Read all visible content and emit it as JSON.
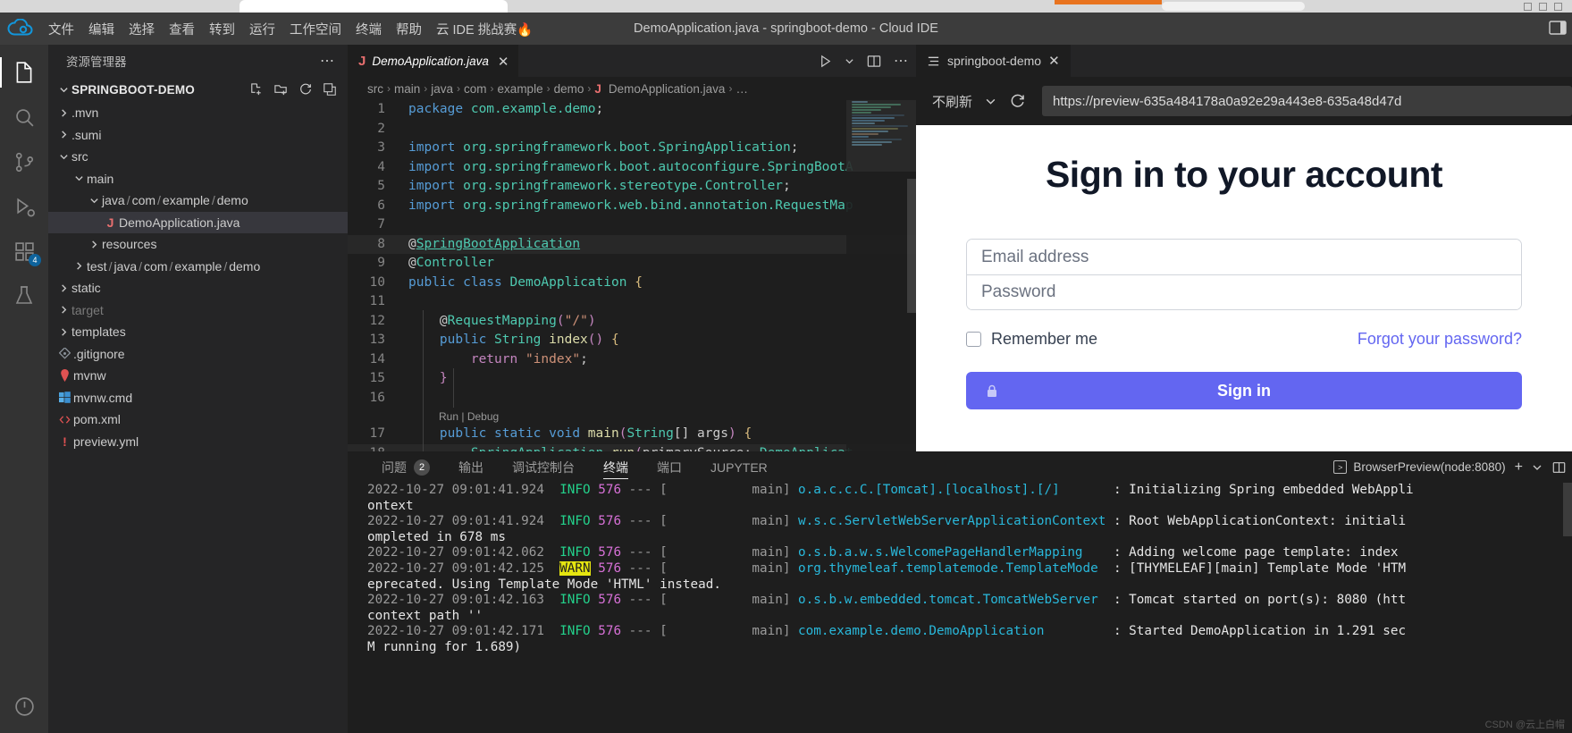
{
  "window": {
    "title": "DemoApplication.java - springboot-demo - Cloud IDE"
  },
  "menubar": {
    "logo": "cloud-logo-icon",
    "items": [
      {
        "label": "文件"
      },
      {
        "label": "编辑"
      },
      {
        "label": "选择"
      },
      {
        "label": "查看"
      },
      {
        "label": "转到"
      },
      {
        "label": "运行"
      },
      {
        "label": "工作空间"
      },
      {
        "label": "终端"
      },
      {
        "label": "帮助"
      },
      {
        "label": "云 IDE 挑战赛🔥"
      }
    ]
  },
  "activitybar": {
    "items": [
      {
        "name": "explorer",
        "icon": "files-icon",
        "active": true,
        "badge": ""
      },
      {
        "name": "search",
        "icon": "search-icon",
        "active": false,
        "badge": ""
      },
      {
        "name": "source-control",
        "icon": "source-control-icon",
        "active": false,
        "badge": ""
      },
      {
        "name": "run-and-debug",
        "icon": "debug-icon",
        "active": false,
        "badge": ""
      },
      {
        "name": "extensions",
        "icon": "extensions-icon",
        "active": false,
        "badge": "4"
      },
      {
        "name": "testing",
        "icon": "beaker-icon",
        "active": false,
        "badge": ""
      },
      {
        "name": "power",
        "icon": "power-icon",
        "active": false,
        "badge": ""
      }
    ]
  },
  "explorer": {
    "title": "资源管理器",
    "more_label": "⋯",
    "root": {
      "label": "SPRINGBOOT-DEMO",
      "actions": [
        "new-file-icon",
        "new-folder-icon",
        "refresh-icon",
        "collapse-all-icon"
      ]
    },
    "tree": [
      {
        "label": ".mvn",
        "indent": 1,
        "type": "folder",
        "expanded": false,
        "icon": "chevron-right-icon"
      },
      {
        "label": ".sumi",
        "indent": 1,
        "type": "folder",
        "expanded": false,
        "icon": "chevron-right-icon"
      },
      {
        "label": "src",
        "indent": 1,
        "type": "folder",
        "expanded": true,
        "icon": "chevron-down-icon"
      },
      {
        "label": "main",
        "indent": 2,
        "type": "folder",
        "expanded": true,
        "icon": "chevron-down-icon"
      },
      {
        "label": "java / com / example / demo",
        "indent": 3,
        "type": "folder",
        "expanded": true,
        "icon": "chevron-down-icon"
      },
      {
        "label": "DemoApplication.java",
        "indent": 4,
        "type": "java",
        "selected": true,
        "icon": "java-icon"
      },
      {
        "label": "resources",
        "indent": 3,
        "type": "folder",
        "expanded": false,
        "icon": "chevron-right-icon"
      },
      {
        "label": "test / java / com / example / demo",
        "indent": 2,
        "type": "folder",
        "expanded": false,
        "icon": "chevron-right-icon"
      },
      {
        "label": "static",
        "indent": 1,
        "type": "folder",
        "expanded": false,
        "icon": "chevron-right-icon"
      },
      {
        "label": "target",
        "indent": 1,
        "type": "folder",
        "expanded": false,
        "dim": true,
        "icon": "chevron-right-icon"
      },
      {
        "label": "templates",
        "indent": 1,
        "type": "folder",
        "expanded": false,
        "icon": "chevron-right-icon"
      },
      {
        "label": ".gitignore",
        "indent": 1,
        "type": "git",
        "icon": "git-icon"
      },
      {
        "label": "mvnw",
        "indent": 1,
        "type": "maven",
        "icon": "maven-icon"
      },
      {
        "label": "mvnw.cmd",
        "indent": 1,
        "type": "windows",
        "icon": "windows-icon"
      },
      {
        "label": "pom.xml",
        "indent": 1,
        "type": "xml",
        "icon": "xml-icon"
      },
      {
        "label": "preview.yml",
        "indent": 1,
        "type": "yml",
        "icon": "yml-icon"
      }
    ]
  },
  "editor": {
    "tab": {
      "label": "DemoApplication.java",
      "icon": "java-icon",
      "close": "✕"
    },
    "actions": [
      "run-icon",
      "chevron-down-icon",
      "split-editor-icon",
      "more-icon"
    ],
    "breadcrumb": [
      "src",
      "main",
      "java",
      "com",
      "example",
      "demo",
      "DemoApplication.java",
      "…"
    ],
    "breadcrumb_sep": "›",
    "codelens": {
      "run": "Run",
      "sep": "|",
      "debug": "Debug",
      "line": 16
    },
    "lines": [
      {
        "n": 1,
        "tokens": [
          {
            "t": "package ",
            "c": "k"
          },
          {
            "t": "com.example.demo",
            "c": "t"
          },
          {
            "t": ";",
            "c": "pl"
          }
        ]
      },
      {
        "n": 2,
        "tokens": []
      },
      {
        "n": 3,
        "tokens": [
          {
            "t": "import ",
            "c": "k"
          },
          {
            "t": "org.springframework.boot.SpringApplication",
            "c": "t"
          },
          {
            "t": ";",
            "c": "pl"
          }
        ]
      },
      {
        "n": 4,
        "tokens": [
          {
            "t": "import ",
            "c": "k"
          },
          {
            "t": "org.springframework.boot.autoconfigure.SpringBootA",
            "c": "t"
          }
        ]
      },
      {
        "n": 5,
        "tokens": [
          {
            "t": "import ",
            "c": "k"
          },
          {
            "t": "org.springframework.stereotype.Controller",
            "c": "t"
          },
          {
            "t": ";",
            "c": "pl"
          }
        ]
      },
      {
        "n": 6,
        "tokens": [
          {
            "t": "import ",
            "c": "k"
          },
          {
            "t": "org.springframework.web.bind.annotation.RequestMap",
            "c": "t"
          }
        ]
      },
      {
        "n": 7,
        "tokens": []
      },
      {
        "n": 8,
        "tokens": [
          {
            "t": "@",
            "c": "pl"
          },
          {
            "t": "SpringBootApplication",
            "c": "anu"
          }
        ]
      },
      {
        "n": 9,
        "tokens": [
          {
            "t": "@",
            "c": "pl"
          },
          {
            "t": "Controller",
            "c": "an"
          }
        ]
      },
      {
        "n": 10,
        "tokens": [
          {
            "t": "public ",
            "c": "k"
          },
          {
            "t": "class ",
            "c": "k"
          },
          {
            "t": "DemoApplication",
            "c": "t"
          },
          {
            "t": " ",
            "c": "pl"
          },
          {
            "t": "{",
            "c": "br"
          }
        ]
      },
      {
        "n": 11,
        "tokens": []
      },
      {
        "n": 12,
        "tokens": [
          {
            "t": "    @",
            "c": "pl"
          },
          {
            "t": "RequestMapping",
            "c": "an"
          },
          {
            "t": "(",
            "c": "kp"
          },
          {
            "t": "\"/\"",
            "c": "s"
          },
          {
            "t": ")",
            "c": "kp"
          }
        ]
      },
      {
        "n": 13,
        "tokens": [
          {
            "t": "    ",
            "c": "pl"
          },
          {
            "t": "public ",
            "c": "k"
          },
          {
            "t": "String ",
            "c": "t"
          },
          {
            "t": "index",
            "c": "fn"
          },
          {
            "t": "()",
            "c": "kp"
          },
          {
            "t": " ",
            "c": "pl"
          },
          {
            "t": "{",
            "c": "br"
          }
        ]
      },
      {
        "n": 14,
        "tokens": [
          {
            "t": "        ",
            "c": "pl"
          },
          {
            "t": "return ",
            "c": "kp"
          },
          {
            "t": "\"index\"",
            "c": "s"
          },
          {
            "t": ";",
            "c": "pl"
          }
        ]
      },
      {
        "n": 15,
        "tokens": [
          {
            "t": "    ",
            "c": "pl"
          },
          {
            "t": "}",
            "c": "kp"
          }
        ]
      },
      {
        "n": 16,
        "tokens": []
      },
      {
        "n": 17,
        "tokens": [
          {
            "t": "    ",
            "c": "pl"
          },
          {
            "t": "public ",
            "c": "k"
          },
          {
            "t": "static ",
            "c": "k"
          },
          {
            "t": "void ",
            "c": "k"
          },
          {
            "t": "main",
            "c": "fn"
          },
          {
            "t": "(",
            "c": "kp"
          },
          {
            "t": "String",
            "c": "t"
          },
          {
            "t": "[] ",
            "c": "pl"
          },
          {
            "t": "args",
            "c": "pl"
          },
          {
            "t": ")",
            "c": "kp"
          },
          {
            "t": " ",
            "c": "pl"
          },
          {
            "t": "{",
            "c": "br"
          }
        ]
      },
      {
        "n": 18,
        "tokens": [
          {
            "t": "        ",
            "c": "pl"
          },
          {
            "t": "SpringApplication",
            "c": "t"
          },
          {
            "t": ".",
            "c": "pl"
          },
          {
            "t": "run",
            "c": "fn"
          },
          {
            "t": "(",
            "c": "kp"
          },
          {
            "t": "primarySource:",
            "c": "pl"
          },
          {
            "t": " DemoApplicat",
            "c": "t"
          }
        ]
      }
    ]
  },
  "preview": {
    "tab": {
      "label": "springboot-demo",
      "icon": "preview-icon",
      "close": "✕"
    },
    "toolbar": {
      "refresh_mode": "不刷新",
      "chevron": "chevron-down-icon",
      "reload_icon": "reload-icon",
      "url": "https://preview-635a484178a0a92e29a443e8-635a48d47d"
    },
    "page": {
      "title": "Sign in to your account",
      "email_placeholder": "Email address",
      "password_placeholder": "Password",
      "remember_label": "Remember me",
      "forgot_label": "Forgot your password?",
      "signin_label": "Sign in",
      "lock_icon": "lock-icon",
      "accent_color": "#6366f1"
    }
  },
  "panel": {
    "tabs": [
      {
        "label": "问题",
        "badge": "2",
        "active": false
      },
      {
        "label": "输出",
        "badge": "",
        "active": false
      },
      {
        "label": "调试控制台",
        "badge": "",
        "active": false
      },
      {
        "label": "终端",
        "badge": "",
        "active": true
      },
      {
        "label": "端口",
        "badge": "",
        "active": false
      },
      {
        "label": "JUPYTER",
        "badge": "",
        "active": false
      }
    ],
    "right": {
      "terminal_name": "BrowserPreview(node:8080)",
      "terminal_icon": "terminal-icon",
      "add_icon": "+",
      "split_icon": "split-icon",
      "chevron_icon": "chevron-down-icon",
      "layout_icon": "panel-layout-icon"
    },
    "terminal_lines": [
      {
        "ts": "2022-10-27 09:01:41.924",
        "level": "INFO",
        "pid": "576",
        "thread": "main",
        "cls": "o.a.c.c.C.[Tomcat].[localhost].[/]",
        "msg": "Initializing Spring embedded WebAppli",
        "wrap": "ontext"
      },
      {
        "ts": "2022-10-27 09:01:41.924",
        "level": "INFO",
        "pid": "576",
        "thread": "main",
        "cls": "w.s.c.ServletWebServerApplicationContext",
        "msg": "Root WebApplicationContext: initiali",
        "wrap": "ompleted in 678 ms"
      },
      {
        "ts": "2022-10-27 09:01:42.062",
        "level": "INFO",
        "pid": "576",
        "thread": "main",
        "cls": "o.s.b.a.w.s.WelcomePageHandlerMapping",
        "msg": "Adding welcome page template: index",
        "wrap": ""
      },
      {
        "ts": "2022-10-27 09:01:42.125",
        "level": "WARN",
        "pid": "576",
        "thread": "main",
        "cls": "org.thymeleaf.templatemode.TemplateMode",
        "msg": "[THYMELEAF][main] Template Mode 'HTM",
        "wrap": "eprecated. Using Template Mode 'HTML' instead."
      },
      {
        "ts": "2022-10-27 09:01:42.163",
        "level": "INFO",
        "pid": "576",
        "thread": "main",
        "cls": "o.s.b.w.embedded.tomcat.TomcatWebServer",
        "msg": "Tomcat started on port(s): 8080 (htt",
        "wrap": "context path ''"
      },
      {
        "ts": "2022-10-27 09:01:42.171",
        "level": "INFO",
        "pid": "576",
        "thread": "main",
        "cls": "com.example.demo.DemoApplication",
        "msg": "Started DemoApplication in 1.291 sec",
        "wrap": "M running for 1.689)"
      }
    ],
    "watermark": "CSDN @云上白帽"
  }
}
